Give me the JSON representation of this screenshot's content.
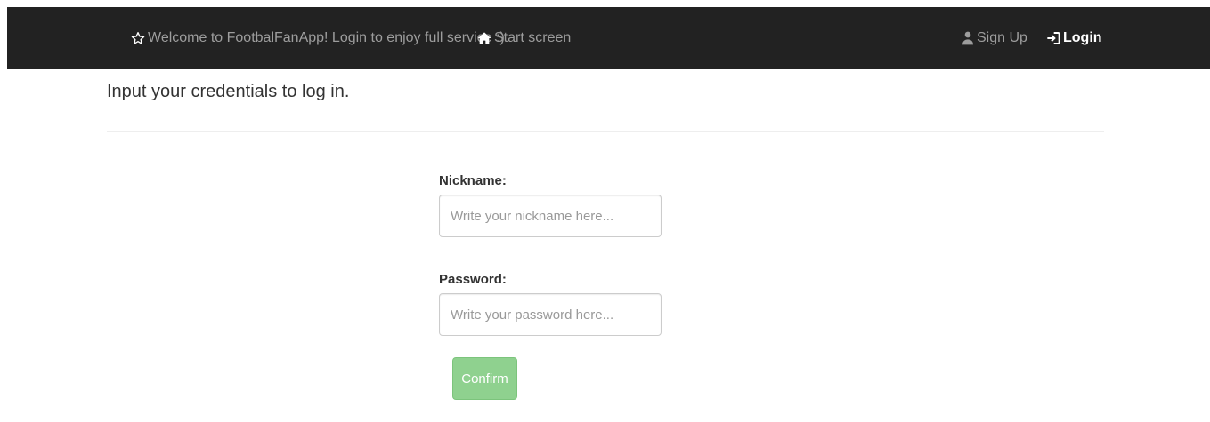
{
  "navbar": {
    "brand": {
      "icon": "star-icon",
      "label": "Welcome to FootbalFanApp! Login to enjoy full service :)"
    },
    "start": {
      "icon": "home-icon",
      "label": "Start screen"
    },
    "signup": {
      "icon": "user-icon",
      "label": "Sign Up"
    },
    "login": {
      "icon": "login-icon",
      "label": "Login"
    }
  },
  "page": {
    "heading": "Input your credentials to log in."
  },
  "form": {
    "nickname_label": "Nickname:",
    "nickname_placeholder": "Write your nickname here...",
    "nickname_value": "",
    "password_label": "Password:",
    "password_placeholder": "Write your password here...",
    "password_value": "",
    "confirm_label": "Confirm"
  },
  "colors": {
    "navbar_bg": "#222222",
    "confirm_button": "#8fd18f"
  }
}
